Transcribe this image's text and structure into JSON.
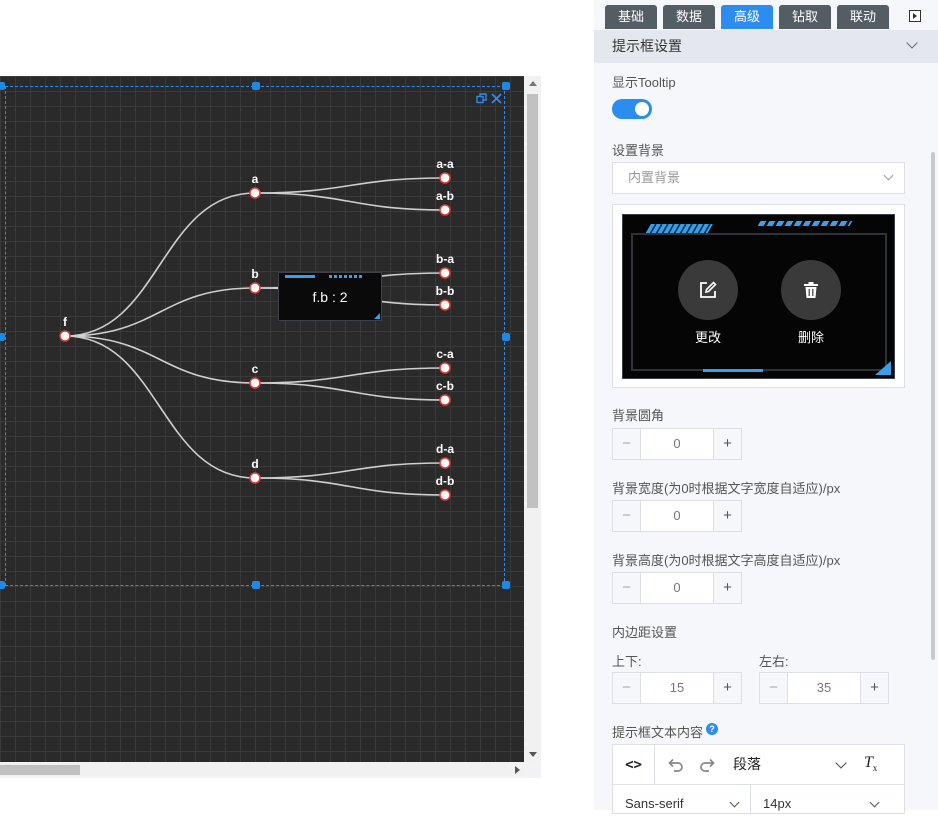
{
  "tooltip_text": "f.b : 2",
  "tree": {
    "root": "f",
    "children": [
      {
        "name": "a",
        "children": [
          "a-a",
          "a-b"
        ]
      },
      {
        "name": "b",
        "children": [
          "b-a",
          "b-b"
        ]
      },
      {
        "name": "c",
        "children": [
          "c-a",
          "c-b"
        ]
      },
      {
        "name": "d",
        "children": [
          "d-a",
          "d-b"
        ]
      }
    ]
  },
  "colors": {
    "canvas_bg": "#2a2a2a",
    "accent": "#2d8cf0",
    "link": "#cfcfcf",
    "node_stroke": "#e53935",
    "tab_bg": "#545c64"
  },
  "tabs": [
    {
      "label": "基础"
    },
    {
      "label": "数据"
    },
    {
      "label": "高级",
      "active": true
    },
    {
      "label": "钻取"
    },
    {
      "label": "联动"
    }
  ],
  "panel": {
    "section_title": "提示框设置",
    "show_tooltip_label": "显示Tooltip",
    "show_tooltip_on": true,
    "bg_label": "设置背景",
    "bg_select_value": "内置背景",
    "edit_label": "更改",
    "delete_label": "删除",
    "radius_label": "背景圆角",
    "radius_value": "0",
    "width_label": "背景宽度(为0时根据文字宽度自适应)/px",
    "width_value": "0",
    "height_label": "背景高度(为0时根据文字高度自适应)/px",
    "height_value": "0",
    "padding_label": "内边距设置",
    "padding_vertical_label": "上下:",
    "padding_vertical_value": "15",
    "padding_horizontal_label": "左右:",
    "padding_horizontal_value": "35",
    "content_label": "提示框文本内容",
    "help_symbol": "?",
    "editor": {
      "code_label": "<>",
      "paragraph": "段落",
      "font": "Sans-serif",
      "size": "14px"
    }
  },
  "icons": [
    "restore-icon",
    "close-icon",
    "edit-icon",
    "trash-icon",
    "undo-icon",
    "redo-icon",
    "clear-format-icon",
    "help-icon",
    "chevron-down-icon",
    "play-icon"
  ]
}
